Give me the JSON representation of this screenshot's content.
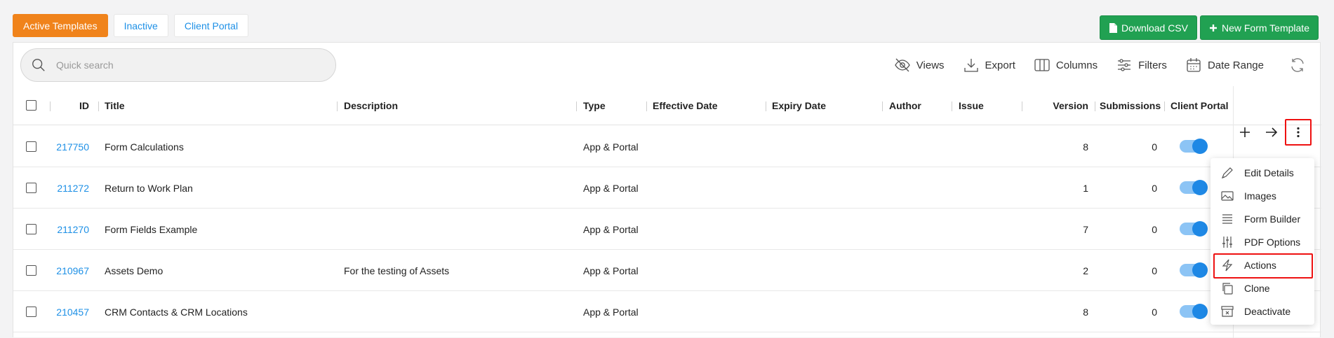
{
  "tabs": [
    {
      "label": "Active Templates",
      "active": true
    },
    {
      "label": "Inactive",
      "active": false
    },
    {
      "label": "Client Portal",
      "active": false
    }
  ],
  "top_actions": {
    "download_csv": "Download CSV",
    "new_template": "New Form Template",
    "accent": "#21a152"
  },
  "search": {
    "placeholder": "Quick search",
    "value": ""
  },
  "toolbar": {
    "views": "Views",
    "export": "Export",
    "columns": "Columns",
    "filters": "Filters",
    "date_range": "Date Range"
  },
  "columns": {
    "id": "ID",
    "title": "Title",
    "description": "Description",
    "type": "Type",
    "effective_date": "Effective Date",
    "expiry_date": "Expiry Date",
    "author": "Author",
    "issue": "Issue",
    "version": "Version",
    "submissions": "Submissions",
    "client_portal": "Client Portal"
  },
  "rows": [
    {
      "id": "217750",
      "title": "Form Calculations",
      "description": "",
      "type": "App & Portal",
      "version": "8",
      "submissions": "0",
      "client_portal": true
    },
    {
      "id": "211272",
      "title": "Return to Work Plan",
      "description": "",
      "type": "App & Portal",
      "version": "1",
      "submissions": "0",
      "client_portal": true
    },
    {
      "id": "211270",
      "title": "Form Fields Example",
      "description": "",
      "type": "App & Portal",
      "version": "7",
      "submissions": "0",
      "client_portal": true
    },
    {
      "id": "210967",
      "title": "Assets Demo",
      "description": "For the testing of Assets",
      "type": "App & Portal",
      "version": "2",
      "submissions": "0",
      "client_portal": true
    },
    {
      "id": "210457",
      "title": "CRM Contacts & CRM Locations",
      "description": "",
      "type": "App & Portal",
      "version": "8",
      "submissions": "0",
      "client_portal": true
    }
  ],
  "context_menu": {
    "items": [
      {
        "label": "Edit Details",
        "icon": "pencil-icon"
      },
      {
        "label": "Images",
        "icon": "image-icon"
      },
      {
        "label": "Form Builder",
        "icon": "form-builder-icon"
      },
      {
        "label": "PDF Options",
        "icon": "sliders-icon"
      },
      {
        "label": "Actions",
        "icon": "lightning-icon",
        "highlighted": true
      },
      {
        "label": "Clone",
        "icon": "clone-icon"
      },
      {
        "label": "Deactivate",
        "icon": "archive-x-icon"
      }
    ]
  },
  "colors": {
    "brand_orange": "#f0831b",
    "link_blue": "#1e90e6",
    "toggle_blue": "#1e88e5",
    "highlight_red": "#e11"
  }
}
